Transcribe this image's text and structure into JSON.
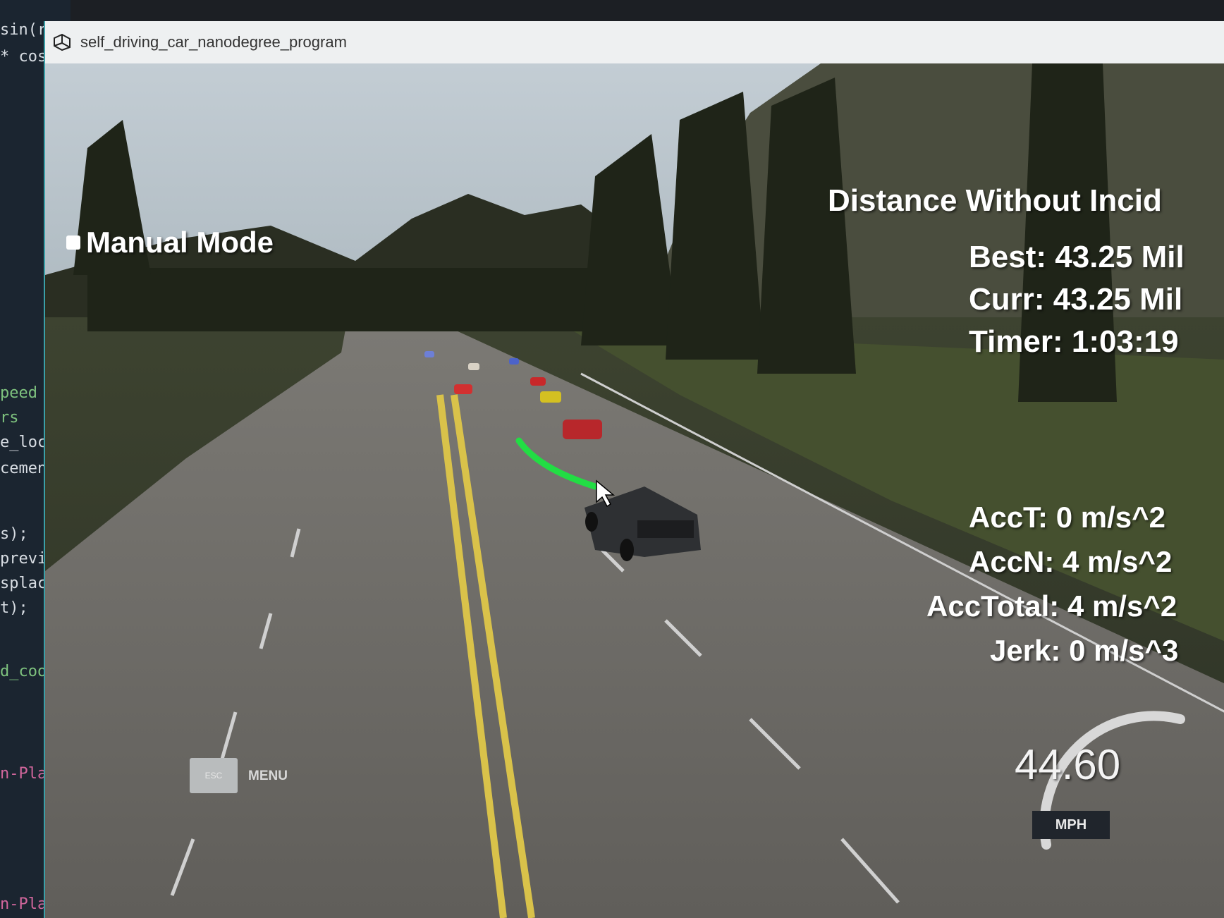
{
  "editor": {
    "lines": [
      {
        "text": "sin(ref_yaw);",
        "style": "normal"
      },
      {
        "text": "* cos",
        "style": "normal"
      },
      {
        "text": "peed li",
        "style": "green"
      },
      {
        "text": "rs",
        "style": "green"
      },
      {
        "text": "e_local",
        "style": "normal"
      },
      {
        "text": "cement",
        "style": "normal"
      },
      {
        "text": "s);",
        "style": "normal"
      },
      {
        "text": "previou",
        "style": "normal"
      },
      {
        "text": "splaceme",
        "style": "normal"
      },
      {
        "text": "t);",
        "style": "normal"
      },
      {
        "text": "d_coordi",
        "style": "green"
      },
      {
        "text": "n-Plannin",
        "style": "pink"
      },
      {
        "text": "n-Planning-Project/build$",
        "style": "pink"
      }
    ]
  },
  "window": {
    "title": "self_driving_car_nanodegree_program"
  },
  "hud": {
    "mode": "Manual Mode",
    "distance_title": "Distance Without Incid",
    "best": "Best: 43.25 Mil",
    "curr": "Curr: 43.25 Mil",
    "timer": "Timer: 1:03:19",
    "acc_t": "AccT: 0 m/s^2",
    "acc_n": "AccN: 4 m/s^2",
    "acc_total": "AccTotal: 4 m/s^2",
    "jerk": "Jerk: 0 m/s^3"
  },
  "speedometer": {
    "value": "44.60",
    "unit": "MPH"
  },
  "menu": {
    "key": "ESC",
    "label": "MENU"
  },
  "colors": {
    "path": "#22dd44",
    "lane_yellow": "#d9c24a",
    "road": "#6c6a66"
  },
  "other_cars": [
    "red",
    "yellow",
    "red",
    "white",
    "blue",
    "red",
    "white"
  ]
}
